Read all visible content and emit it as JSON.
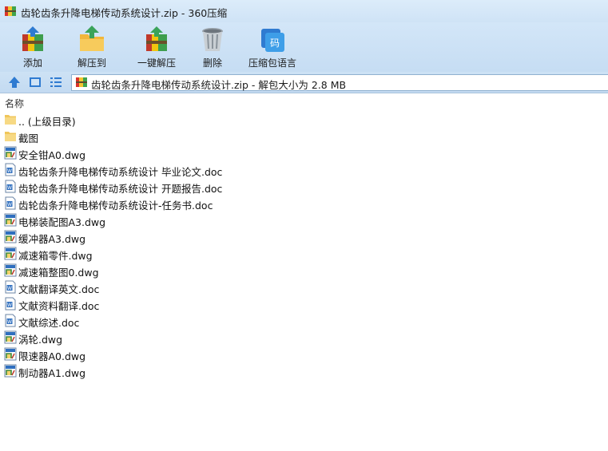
{
  "window": {
    "title": "齿轮齿条升降电梯传动系统设计.zip - 360压缩"
  },
  "toolbar": {
    "buttons": [
      {
        "label": "添加",
        "icon": "add-archive-icon"
      },
      {
        "label": "解压到",
        "icon": "extract-to-icon"
      },
      {
        "label": "一键解压",
        "icon": "one-click-extract-icon"
      },
      {
        "label": "删除",
        "icon": "delete-trash-icon"
      },
      {
        "label": "压缩包语言",
        "icon": "archive-language-icon"
      }
    ]
  },
  "addressbar": {
    "path": "齿轮齿条升降电梯传动系统设计.zip - 解包大小为 2.8 MB"
  },
  "list": {
    "header": "名称",
    "items": [
      {
        "name": ".. (上级目录)",
        "type": "folder"
      },
      {
        "name": "截图",
        "type": "folder"
      },
      {
        "name": "安全钳A0.dwg",
        "type": "dwg"
      },
      {
        "name": "齿轮齿条升降电梯传动系统设计 毕业论文.doc",
        "type": "doc"
      },
      {
        "name": "齿轮齿条升降电梯传动系统设计 开题报告.doc",
        "type": "doc"
      },
      {
        "name": "齿轮齿条升降电梯传动系统设计-任务书.doc",
        "type": "doc"
      },
      {
        "name": "电梯装配图A3.dwg",
        "type": "dwg"
      },
      {
        "name": "缓冲器A3.dwg",
        "type": "dwg"
      },
      {
        "name": "减速箱零件.dwg",
        "type": "dwg"
      },
      {
        "name": "减速箱整图0.dwg",
        "type": "dwg"
      },
      {
        "name": "文献翻译英文.doc",
        "type": "doc"
      },
      {
        "name": "文献资料翻译.doc",
        "type": "doc"
      },
      {
        "name": "文献综述.doc",
        "type": "doc"
      },
      {
        "name": "涡轮.dwg",
        "type": "dwg"
      },
      {
        "name": "限速器A0.dwg",
        "type": "dwg"
      },
      {
        "name": "制动器A1.dwg",
        "type": "dwg"
      }
    ]
  }
}
